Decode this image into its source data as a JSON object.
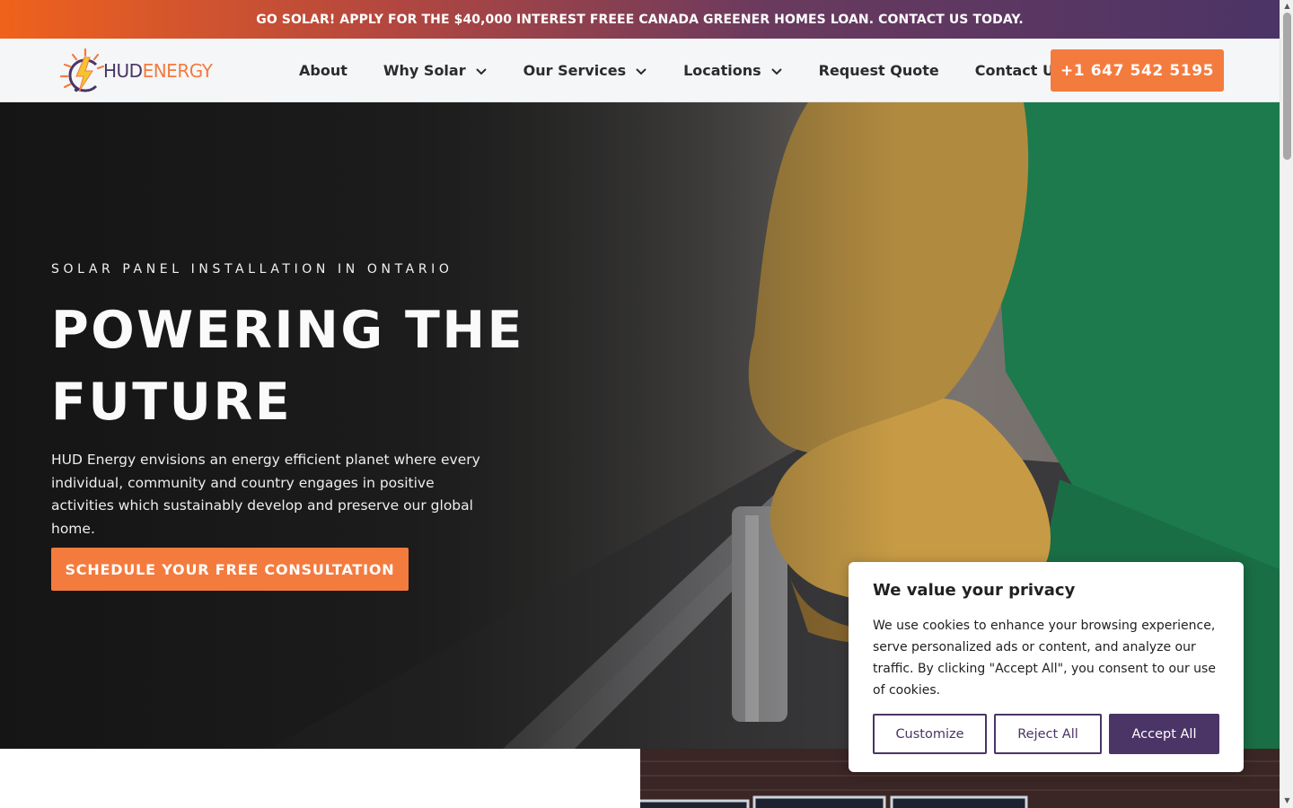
{
  "promo": {
    "text": "GO SOLAR! APPLY FOR THE $40,000 INTEREST FREEE CANADA GREENER HOMES LOAN. CONTACT US TODAY."
  },
  "header": {
    "logo": {
      "part1": "HUD",
      "part2": "ENERGY",
      "icon": "sun-lightning-icon"
    },
    "nav": [
      {
        "label": "About",
        "dropdown": false
      },
      {
        "label": "Why Solar",
        "dropdown": true
      },
      {
        "label": "Our Services",
        "dropdown": true
      },
      {
        "label": "Locations",
        "dropdown": true
      },
      {
        "label": "Request Quote",
        "dropdown": false
      },
      {
        "label": "Contact Us",
        "dropdown": false
      }
    ],
    "phone": "+1 647 542 5195"
  },
  "hero": {
    "eyebrow": "SOLAR PANEL INSTALLATION IN ONTARIO",
    "headline": "POWERING THE FUTURE",
    "description": "HUD Energy envisions an energy efficient planet where every individual, community and country engages in positive activities which sustainably develop and preserve our global home.",
    "cta": "SCHEDULE YOUR FREE CONSULTATION"
  },
  "cookie": {
    "title": "We value your privacy",
    "text": "We use cookies to enhance your browsing experience, serve personalized ads or content, and analyze our traffic. By clicking \"Accept All\", you consent to our use of cookies.",
    "customize": "Customize",
    "reject": "Reject All",
    "accept": "Accept All"
  },
  "colors": {
    "accent": "#f47b3e",
    "brand": "#4b3466"
  }
}
